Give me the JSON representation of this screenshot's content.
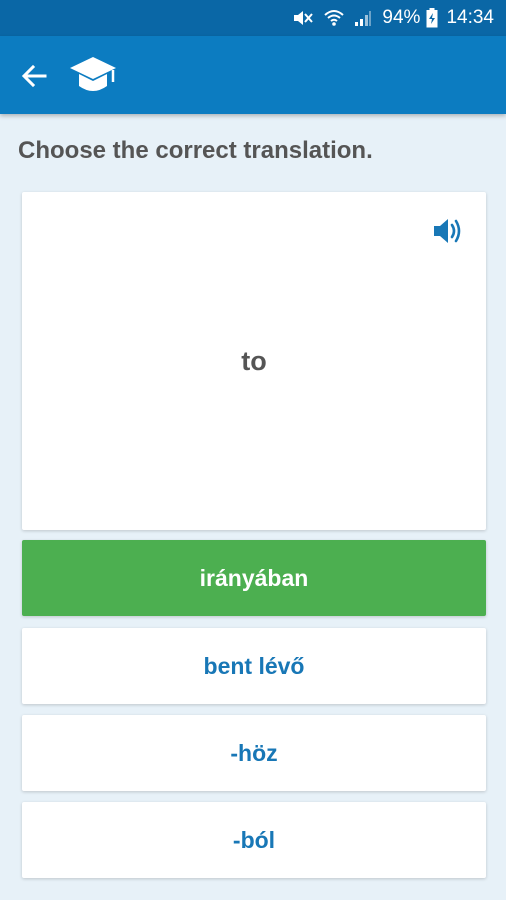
{
  "status_bar": {
    "battery": "94%",
    "time": "14:34",
    "icons": [
      "mute-icon",
      "wifi-icon",
      "signal-icon",
      "battery-charging-icon"
    ]
  },
  "app_bar": {
    "icons": [
      "back-arrow-icon",
      "graduation-cap-icon"
    ]
  },
  "quiz": {
    "prompt": "Choose the correct translation.",
    "word": "to",
    "speaker_icon": "speaker-icon",
    "answers": [
      {
        "label": "irányában",
        "state": "correct"
      },
      {
        "label": "bent lévő",
        "state": "default"
      },
      {
        "label": "-höz",
        "state": "default"
      },
      {
        "label": "-ból",
        "state": "default"
      }
    ]
  },
  "colors": {
    "status_bar": "#0a67a6",
    "app_bar": "#0c7cc1",
    "background": "#e7f1f8",
    "correct": "#4caf50",
    "answer_text": "#1877b6"
  }
}
